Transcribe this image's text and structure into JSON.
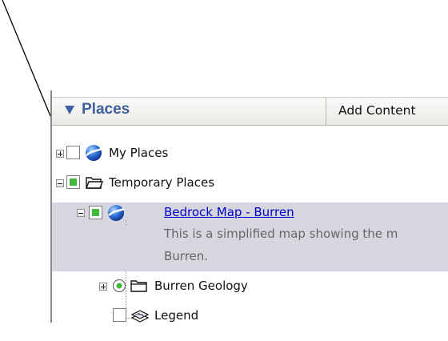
{
  "panel": {
    "title": "Places",
    "add_content_label": "Add Content"
  },
  "tree": {
    "my_places": {
      "label": "My Places",
      "checked": false,
      "icon": "globe-icon"
    },
    "temporary_places": {
      "label": "Temporary Places",
      "checked": "partial",
      "icon": "open-folder-icon"
    },
    "bedrock_map": {
      "label": "Bedrock Map - Burren",
      "checked": "partial",
      "icon": "globe-icon",
      "description_line1": "This is a simplified map showing the m",
      "description_line2": "Burren."
    },
    "burren_geology": {
      "label": "Burren Geology",
      "checked": "radio-selected",
      "icon": "folder-icon"
    },
    "legend": {
      "label": "Legend",
      "checked": false,
      "icon": "layers-icon"
    }
  },
  "colors": {
    "title": "#3e5f9b",
    "link": "#0000cc",
    "partial_check": "#3fba3a",
    "selected_row": "#d6d6df"
  }
}
